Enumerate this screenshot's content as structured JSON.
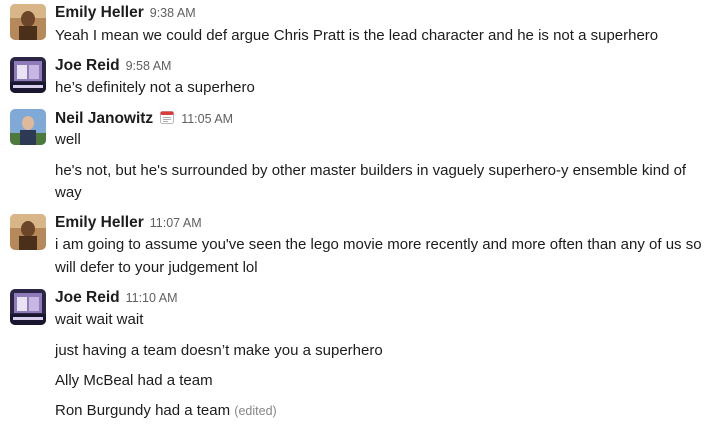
{
  "messages": [
    {
      "author": "Emily Heller",
      "time": "9:38 AM",
      "lines": [
        "Yeah I mean we could def argue Chris Pratt is the lead character and he is not a superhero"
      ]
    },
    {
      "author": "Joe Reid",
      "time": "9:58 AM",
      "lines": [
        "he’s definitely not a superhero"
      ]
    },
    {
      "author": "Neil Janowitz",
      "status_icon": "calendar-icon",
      "time": "11:05 AM",
      "lines": [
        "well",
        "he's not, but he's surrounded by other master builders in vaguely superhero-y ensemble kind of",
        "way"
      ]
    },
    {
      "author": "Emily Heller",
      "time": "11:07 AM",
      "lines": [
        "i am going to assume you've seen the lego movie more recently and more often than any of us so",
        "will defer to your judgement lol"
      ]
    },
    {
      "author": "Joe Reid",
      "time": "11:10 AM",
      "lines": [
        "wait wait wait",
        "just having a team doesn’t make you a superhero",
        "Ally McBeal had a team",
        "Ron Burgundy had a team"
      ],
      "edited_label": "(edited)"
    }
  ],
  "colors": {
    "text": "#1d1c1d",
    "timestamp": "#616061",
    "edited": "#868686",
    "background": "#ffffff"
  }
}
